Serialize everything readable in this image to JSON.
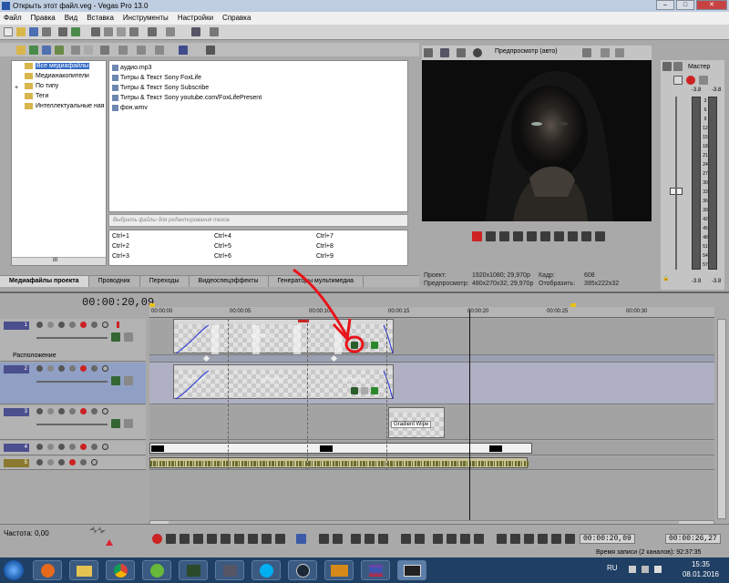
{
  "window": {
    "title": "Открыть этот файл.veg - Vegas Pro 13.0",
    "buttons": [
      "–",
      "□",
      "✕"
    ]
  },
  "menu": [
    "Файл",
    "Правка",
    "Вид",
    "Вставка",
    "Инструменты",
    "Настройки",
    "Справка"
  ],
  "media": {
    "tree": [
      {
        "label": "Все медиафайлы",
        "selected": true
      },
      {
        "label": "Медианакопители",
        "selected": false
      },
      {
        "label": "По типу",
        "selected": false
      },
      {
        "label": "Теги",
        "selected": false
      },
      {
        "label": "Интеллектуальные ная",
        "selected": false
      }
    ],
    "files": [
      "аудио.mp3",
      "Титры & Текст Sony FoxLife",
      "Титры & Текст Sony Subscribe",
      "Титры & Текст Sony youtube.com/FoxLifePresent",
      "фон.wmv"
    ],
    "filter_placeholder": "Выбрать файлы для редактирования тегов",
    "shortcuts": [
      "Ctrl+1",
      "Ctrl+4",
      "Ctrl+7",
      "Ctrl+2",
      "Ctrl+5",
      "Ctrl+8",
      "Ctrl+3",
      "Ctrl+6",
      "Ctrl+9"
    ],
    "tabs": [
      "Медиафайлы проекта",
      "Проводник",
      "Переходы",
      "Видеоспецэффекты",
      "Генераторы мультимедиа"
    ],
    "scroll_label": "III"
  },
  "preview": {
    "mode": "Предпросмотр (авто)",
    "labels": {
      "project": "Проект:",
      "preview": "Предпросмотр:",
      "frame": "Кадр:",
      "display": "Отобразить:"
    },
    "values": {
      "project": "1920x1080; 29,970p",
      "preview": "480x270x32; 29,970p",
      "frame": "608",
      "display": "395x222x32"
    }
  },
  "master": {
    "title": "Мастер",
    "levels": [
      "-3.8",
      "-3.8"
    ],
    "scale": [
      "3",
      "6",
      "9",
      "12",
      "15",
      "18",
      "21",
      "24",
      "27",
      "30",
      "33",
      "36",
      "39",
      "42",
      "45",
      "48",
      "51",
      "54",
      "57"
    ]
  },
  "timeline": {
    "timecode": "00:00:20,09",
    "ruler": [
      "00:00:00",
      "00:00:05",
      "00:00:10",
      "00:00:15",
      "00:00:20",
      "00:00:25",
      "00:00:30"
    ],
    "tracks": [
      {
        "num": "1",
        "type": "video",
        "sub_label": "Расположение"
      },
      {
        "num": "2",
        "type": "video"
      },
      {
        "num": "3",
        "type": "video"
      },
      {
        "num": "4",
        "type": "video"
      },
      {
        "num": "5",
        "type": "audio"
      }
    ],
    "clip_text": "!!!!!!!!!!!!!!! ...",
    "transition_label": "Gradient Wipe"
  },
  "transport": {
    "rate_label": "Частота: 0,00",
    "timecode": "00:00:20,09",
    "end_time": "00:00:26,27",
    "record_time": "Время записи (2 каналов): 92:37:35"
  },
  "taskbar": {
    "lang": "RU",
    "time": "15:35",
    "date": "08.01.2016"
  },
  "colors": {
    "accent": "#3169c6",
    "annotation": "#e8141a"
  }
}
